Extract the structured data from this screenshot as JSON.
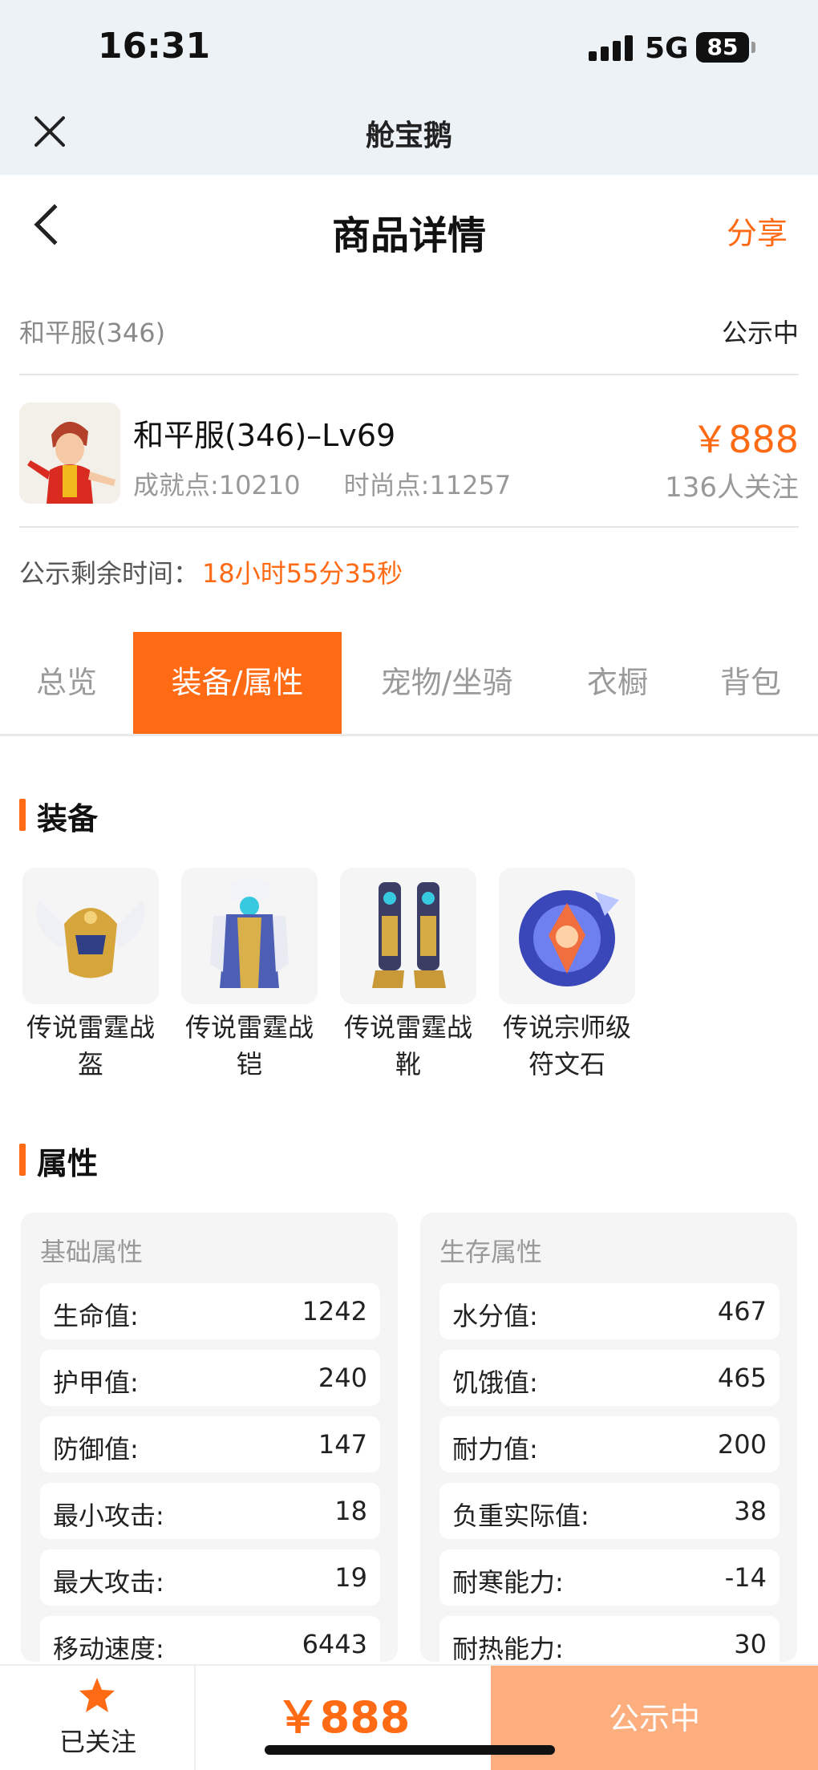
{
  "status_bar": {
    "time": "16:31",
    "network": "5G",
    "battery": "85"
  },
  "app_header": {
    "title": "舱宝鹅"
  },
  "page_nav": {
    "title": "商品详情",
    "share_label": "分享"
  },
  "server": {
    "name": "和平服(346)",
    "status": "公示中"
  },
  "product": {
    "title": "和平服(346)–Lv69",
    "achievement": "成就点:10210",
    "fashion": "时尚点:11257",
    "price": "￥888",
    "followers": "136人关注"
  },
  "countdown": {
    "label": "公示剩余时间：",
    "time": "18小时55分35秒"
  },
  "tabs": [
    {
      "label": "总览"
    },
    {
      "label": "装备/属性"
    },
    {
      "label": "宠物/坐骑"
    },
    {
      "label": "衣橱"
    },
    {
      "label": "背包"
    }
  ],
  "active_tab": "装备/属性",
  "equipment": {
    "title": "装备",
    "items": [
      {
        "name": "传说雷霆战盔",
        "icon": "helmet-icon"
      },
      {
        "name": "传说雷霆战铠",
        "icon": "armor-icon"
      },
      {
        "name": "传说雷霆战靴",
        "icon": "boots-icon"
      },
      {
        "name": "传说宗师级符文石",
        "icon": "rune-stone-icon"
      }
    ]
  },
  "attributes": {
    "title": "属性",
    "basic": {
      "title": "基础属性",
      "rows": [
        {
          "label": "生命值:",
          "value": "1242"
        },
        {
          "label": "护甲值:",
          "value": "240"
        },
        {
          "label": "防御值:",
          "value": "147"
        },
        {
          "label": "最小攻击:",
          "value": "18"
        },
        {
          "label": "最大攻击:",
          "value": "19"
        },
        {
          "label": "移动速度:",
          "value": "6443"
        }
      ]
    },
    "survival": {
      "title": "生存属性",
      "rows": [
        {
          "label": "水分值:",
          "value": "467"
        },
        {
          "label": "饥饿值:",
          "value": "465"
        },
        {
          "label": "耐力值:",
          "value": "200"
        },
        {
          "label": "负重实际值:",
          "value": "38"
        },
        {
          "label": "耐寒能力:",
          "value": "-14"
        },
        {
          "label": "耐热能力:",
          "value": "30"
        }
      ]
    }
  },
  "bottom_bar": {
    "follow_label": "已关注",
    "price": "￥888",
    "action_label": "公示中"
  },
  "colors": {
    "accent": "#ff6a14",
    "action_button": "#fdae7e",
    "panel_bg": "#f5f5f5",
    "header_bg": "#ecf2f6"
  }
}
